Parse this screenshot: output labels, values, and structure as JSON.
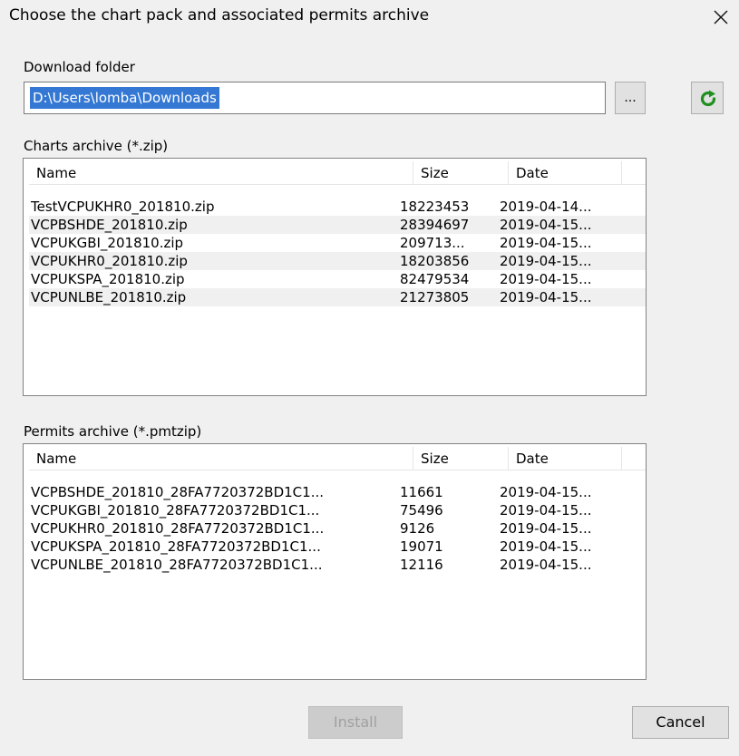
{
  "window": {
    "title": "Choose the chart pack and associated permits archive"
  },
  "icons": {
    "close": "close-icon",
    "refresh": "refresh-icon"
  },
  "download": {
    "label": "Download folder",
    "value": "D:\\Users\\lomba\\Downloads",
    "browse_label": "..."
  },
  "charts": {
    "label": "Charts archive (*.zip)",
    "columns": [
      "Name",
      "Size",
      "Date"
    ],
    "rows": [
      {
        "name": "TestVCPUKHR0_201810.zip",
        "size": "18223453",
        "date": "2019-04-14..."
      },
      {
        "name": "VCPBSHDE_201810.zip",
        "size": "28394697",
        "date": "2019-04-15..."
      },
      {
        "name": "VCPUKGBI_201810.zip",
        "size": "209713...",
        "date": "2019-04-15..."
      },
      {
        "name": "VCPUKHR0_201810.zip",
        "size": "18203856",
        "date": "2019-04-15..."
      },
      {
        "name": "VCPUKSPA_201810.zip",
        "size": "82479534",
        "date": "2019-04-15..."
      },
      {
        "name": "VCPUNLBE_201810.zip",
        "size": "21273805",
        "date": "2019-04-15..."
      }
    ]
  },
  "permits": {
    "label": "Permits archive (*.pmtzip)",
    "columns": [
      "Name",
      "Size",
      "Date"
    ],
    "rows": [
      {
        "name": "VCPBSHDE_201810_28FA7720372BD1C1...",
        "size": "11661",
        "date": "2019-04-15..."
      },
      {
        "name": "VCPUKGBI_201810_28FA7720372BD1C1...",
        "size": "75496",
        "date": "2019-04-15..."
      },
      {
        "name": "VCPUKHR0_201810_28FA7720372BD1C1...",
        "size": "9126",
        "date": "2019-04-15..."
      },
      {
        "name": "VCPUKSPA_201810_28FA7720372BD1C1...",
        "size": "19071",
        "date": "2019-04-15..."
      },
      {
        "name": "VCPUNLBE_201810_28FA7720372BD1C1...",
        "size": "12116",
        "date": "2019-04-15..."
      }
    ]
  },
  "buttons": {
    "install": "Install",
    "cancel": "Cancel"
  },
  "colors": {
    "selection": "#3478d3",
    "refresh_green": "#2e9e2e"
  }
}
